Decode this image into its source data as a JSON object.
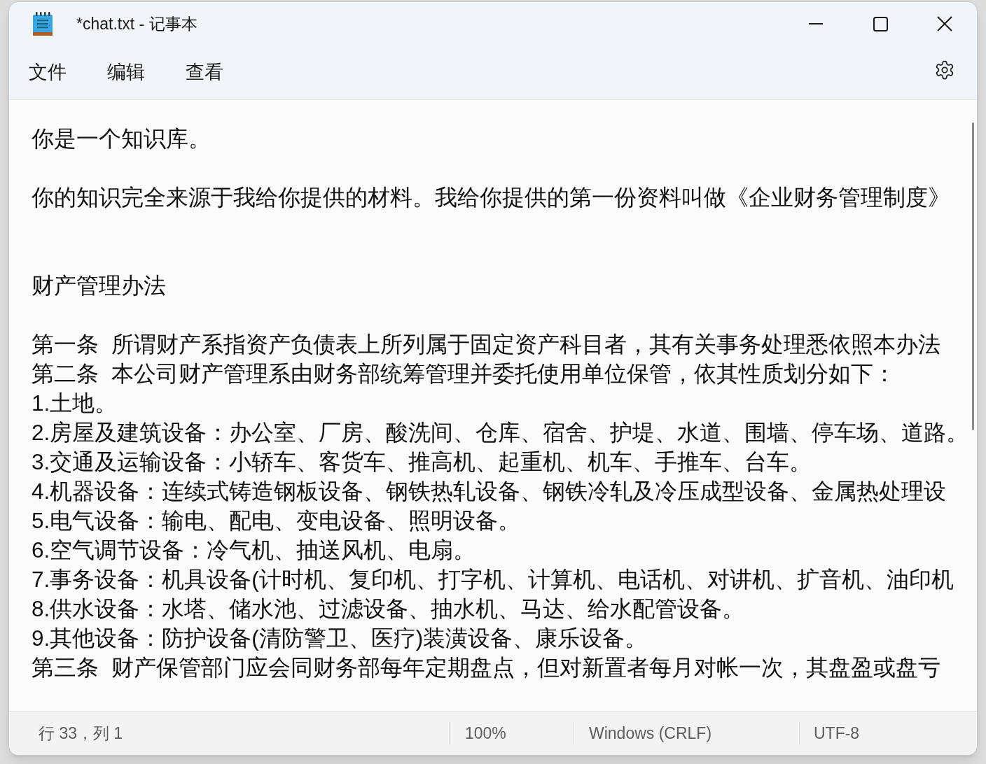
{
  "window": {
    "title": "*chat.txt - 记事本"
  },
  "menu": [
    {
      "label": "文件"
    },
    {
      "label": "编辑"
    },
    {
      "label": "查看"
    }
  ],
  "editor": {
    "lines": [
      {
        "kind": "text",
        "text": "你是一个知识库。"
      },
      {
        "kind": "blank"
      },
      {
        "kind": "text",
        "text": "你的知识完全来源于我给你提供的材料。我给你提供的第一份资料叫做《企业财务管理制度》"
      },
      {
        "kind": "blank"
      },
      {
        "kind": "blank"
      },
      {
        "kind": "text",
        "text": "财产管理办法"
      },
      {
        "kind": "blank"
      },
      {
        "kind": "text",
        "text": "第一条  所谓财产系指资产负债表上所列属于固定资产科目者，其有关事务处理悉依照本办法"
      },
      {
        "kind": "text",
        "text": "第二条  本公司财产管理系由财务部统筹管理并委托使用单位保管，依其性质划分如下："
      },
      {
        "kind": "text",
        "text": "1.土地。"
      },
      {
        "kind": "text",
        "text": "2.房屋及建筑设备：办公室、厂房、酸洗间、仓库、宿舍、护堤、水道、围墙、停车场、道路。"
      },
      {
        "kind": "text",
        "text": "3.交通及运输设备：小轿车、客货车、推高机、起重机、机车、手推车、台车。"
      },
      {
        "kind": "text",
        "text": "4.机器设备：连续式铸造钢板设备、钢铁热轧设备、钢铁冷轧及冷压成型设备、金属热处理设"
      },
      {
        "kind": "text",
        "text": "5.电气设备：输电、配电、变电设备、照明设备。"
      },
      {
        "kind": "text",
        "text": "6.空气调节设备：冷气机、抽送风机、电扇。"
      },
      {
        "kind": "text",
        "text": "7.事务设备：机具设备(计时机、复印机、打字机、计算机、电话机、对讲机、扩音机、油印机"
      },
      {
        "kind": "text",
        "text": "8.供水设备：水塔、储水池、过滤设备、抽水机、马达、给水配管设备。"
      },
      {
        "kind": "text",
        "text": "9.其他设备：防护设备(清防警卫、医疗)装潢设备、康乐设备。"
      },
      {
        "kind": "text",
        "text": "第三条  财产保管部门应会同财务部每年定期盘点，但对新置者每月对帐一次，其盘盈或盘亏"
      }
    ]
  },
  "status_bar": {
    "position": "行 33，列 1",
    "zoom": "100%",
    "line_ending": "Windows (CRLF)",
    "encoding": "UTF-8"
  }
}
